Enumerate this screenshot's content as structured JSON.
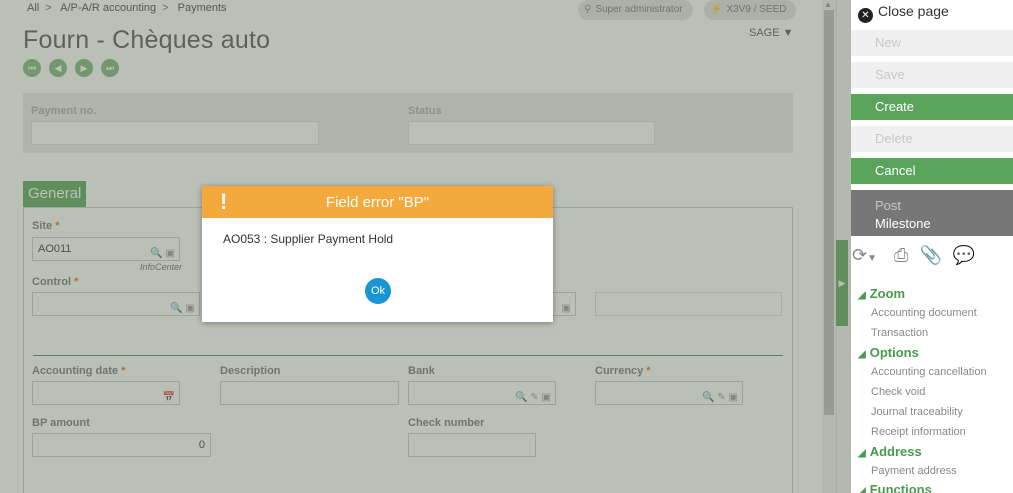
{
  "breadcrumb": [
    "All",
    "A/P-A/R accounting",
    "Payments"
  ],
  "user": {
    "role": "Super administrator",
    "folder": "X3V9 / SEED"
  },
  "page_title": "Fourn - Chèques auto",
  "company_selector": "SAGE",
  "nav_buttons": [
    "first",
    "previous",
    "next",
    "last"
  ],
  "header": {
    "payment_no_label": "Payment no.",
    "payment_no_value": "",
    "status_label": "Status",
    "status_value": ""
  },
  "tab_general": "General",
  "form": {
    "site_label": "Site",
    "site_value": "AO011",
    "infocenter": "InfoCenter",
    "control_label": "Control",
    "control_value": "",
    "accounting_date_label": "Accounting date",
    "description_label": "Description",
    "bank_label": "Bank",
    "currency_label": "Currency",
    "bp_amount_label": "BP amount",
    "bp_amount_value": "0",
    "check_number_label": "Check number"
  },
  "right_panel": {
    "close_page": "Close page",
    "actions": {
      "new": "New",
      "save": "Save",
      "create": "Create",
      "delete": "Delete",
      "cancel": "Cancel",
      "post": "Post",
      "milestone": "Milestone"
    },
    "groups": {
      "zoom": {
        "title": "Zoom",
        "links": [
          "Accounting document",
          "Transaction"
        ]
      },
      "options": {
        "title": "Options",
        "links": [
          "Accounting cancellation",
          "Check void",
          "Journal traceability",
          "Receipt information"
        ]
      },
      "address": {
        "title": "Address",
        "links": [
          "Payment address"
        ]
      },
      "functions": {
        "title": "Functions"
      }
    }
  },
  "dialog": {
    "title": "Field error \"BP\"",
    "icon": "!",
    "message": "AO053 : Supplier Payment Hold",
    "ok_label": "Ok"
  },
  "colors": {
    "accent_green": "#5aa45c",
    "dialog_header": "#f4a93c",
    "ok_button": "#1a95d4"
  }
}
